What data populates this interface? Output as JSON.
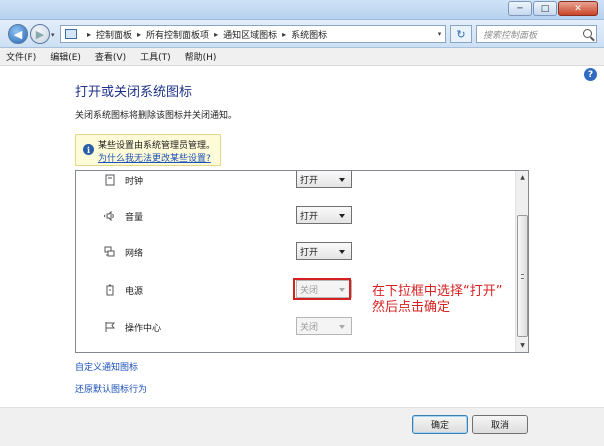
{
  "window": {
    "min_glyph": "─",
    "max_glyph": "□",
    "close_glyph": "✕"
  },
  "nav": {
    "back_glyph": "◀",
    "forward_glyph": "▶",
    "dropdown_glyph": "▾",
    "refresh_glyph": "↻"
  },
  "address": {
    "crumbs": [
      "控制面板",
      "所有控制面板项",
      "通知区域图标",
      "系统图标"
    ],
    "separator": "▸"
  },
  "search": {
    "placeholder": "搜索控制面板"
  },
  "menu": [
    "文件(F)",
    "编辑(E)",
    "查看(V)",
    "工具(T)",
    "帮助(H)"
  ],
  "help_glyph": "?",
  "page": {
    "title": "打开或关闭系统图标",
    "description": "关闭系统图标将删除该图标并关闭通知。"
  },
  "info": {
    "glyph": "i",
    "message": "某些设置由系统管理员管理。",
    "link": "为什么我无法更改某些设置?"
  },
  "icon_list": [
    {
      "name": "时钟",
      "icon": "clock-icon",
      "value": "打开",
      "enabled": true
    },
    {
      "name": "音量",
      "icon": "volume-icon",
      "value": "打开",
      "enabled": true
    },
    {
      "name": "网络",
      "icon": "network-icon",
      "value": "打开",
      "enabled": true
    },
    {
      "name": "电源",
      "icon": "power-icon",
      "value": "关闭",
      "enabled": false
    },
    {
      "name": "操作中心",
      "icon": "action-center-flag-icon",
      "value": "关闭",
      "enabled": false
    }
  ],
  "annotation": {
    "line1": "在下拉框中选择“打开”",
    "line2": "然后点击确定",
    "color": "#d52020"
  },
  "links": {
    "customize": "自定义通知图标",
    "restore": "还原默认图标行为"
  },
  "buttons": {
    "ok": "确定",
    "cancel": "取消"
  }
}
